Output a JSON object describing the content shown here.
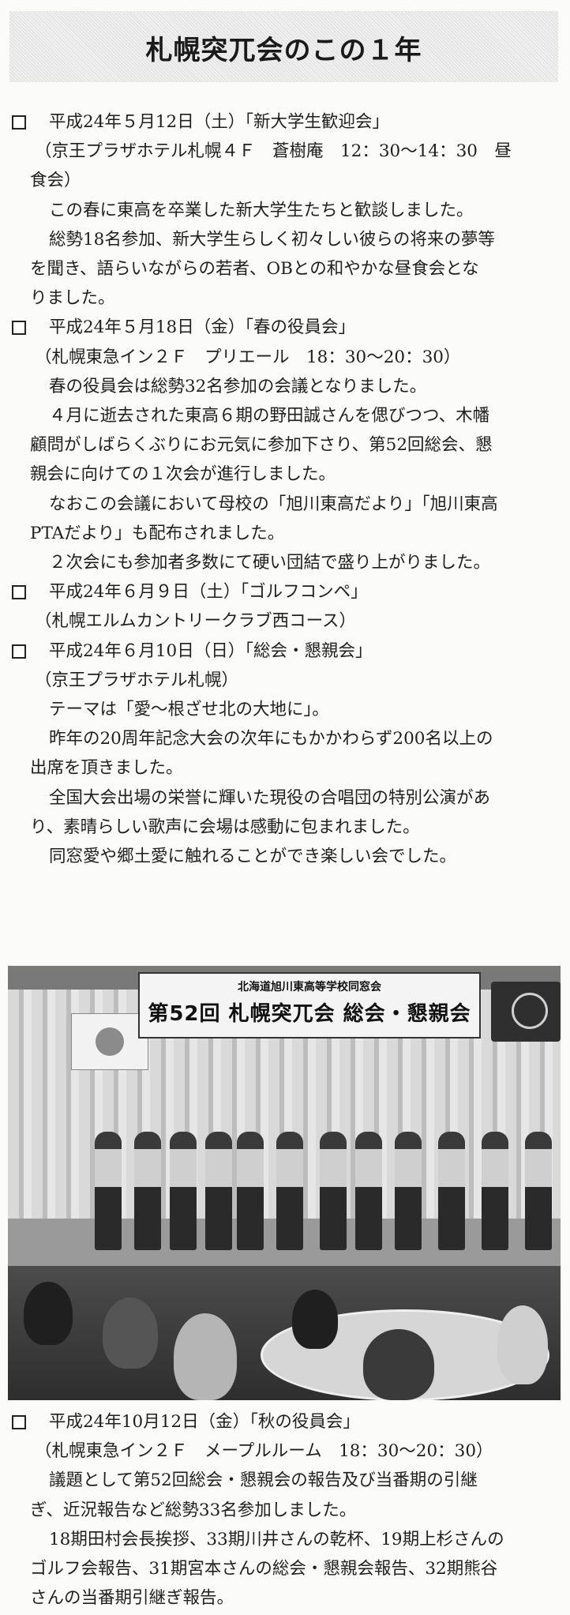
{
  "page_title": "札幌突兀会のこの１年",
  "lines": [
    {
      "cb": true,
      "text": "平成24年５月12日（土）「新大学生歓迎会」"
    },
    {
      "cb": false,
      "text": "（京王プラザホテル札幌４Ｆ　蒼樹庵　12：30～14：30　昼"
    },
    {
      "cb": false,
      "text": "食会）"
    },
    {
      "cb": false,
      "text": "この春に東高を卒業した新大学生たちと歓談しました。"
    },
    {
      "cb": false,
      "text": "総勢18名参加、新大学生らしく初々しい彼らの将来の夢等"
    },
    {
      "cb": false,
      "text": "を聞き、語らいながらの若者、OBとの和やかな昼食会とな"
    },
    {
      "cb": false,
      "text": "りました。"
    },
    {
      "cb": true,
      "text": "平成24年５月18日（金）「春の役員会」"
    },
    {
      "cb": false,
      "text": "（札幌東急イン２Ｆ　プリエール　18：30～20：30）"
    },
    {
      "cb": false,
      "text": "春の役員会は総勢32名参加の会議となりました。"
    },
    {
      "cb": false,
      "text": "４月に逝去された東高６期の野田誠さんを偲びつつ、木幡"
    },
    {
      "cb": false,
      "text": "顧問がしばらくぶりにお元気に参加下さり、第52回総会、懇"
    },
    {
      "cb": false,
      "text": "親会に向けての１次会が進行しました。"
    },
    {
      "cb": false,
      "text": "なおこの会議において母校の「旭川東高だより」「旭川東高"
    },
    {
      "cb": false,
      "text": "PTAだより」も配布されました。"
    },
    {
      "cb": false,
      "text": "２次会にも参加者多数にて硬い団結で盛り上がりました。"
    },
    {
      "cb": true,
      "text": "平成24年６月９日（土）「ゴルフコンペ」"
    },
    {
      "cb": false,
      "text": "（札幌エルムカントリークラブ西コース）"
    },
    {
      "cb": true,
      "text": "平成24年６月10日（日）「総会・懇親会」"
    },
    {
      "cb": false,
      "text": "（京王プラザホテル札幌）"
    },
    {
      "cb": false,
      "text": "テーマは「愛～根ざせ北の大地に」。"
    },
    {
      "cb": false,
      "text": "昨年の20周年記念大会の次年にもかかわらず200名以上の"
    },
    {
      "cb": false,
      "text": "出席を頂きました。"
    },
    {
      "cb": false,
      "text": "全国大会出場の栄誉に輝いた現役の合唱団の特別公演があ"
    },
    {
      "cb": false,
      "text": "り、素晴らしい歌声に会場は感動に包まれました。"
    },
    {
      "cb": false,
      "text": "同窓愛や郷土愛に触れることができ楽しい会でした。"
    },
    {
      "cb": true,
      "text": "平成24年10月12日（金）「秋の役員会」"
    },
    {
      "cb": false,
      "text": "（札幌東急イン２Ｆ　メープルルーム　18：30～20：30）"
    },
    {
      "cb": false,
      "text": "議題として第52回総会・懇親会の報告及び当番期の引継"
    },
    {
      "cb": false,
      "text": "ぎ、近況報告など総勢33名参加しました。"
    },
    {
      "cb": false,
      "text": "18期田村会長挨拶、33期川井さんの乾杯、19期上杉さんの"
    },
    {
      "cb": false,
      "text": "ゴルフ会報告、31期宮本さんの総会・懇親会報告、32期熊谷"
    },
    {
      "cb": false,
      "text": "さんの当番期引継ぎ報告。"
    }
  ],
  "photo": {
    "banner_top": "北海道旭川東高等学校同窓会",
    "banner_main": "第52回 札幌突兀会 総会・懇親会"
  }
}
